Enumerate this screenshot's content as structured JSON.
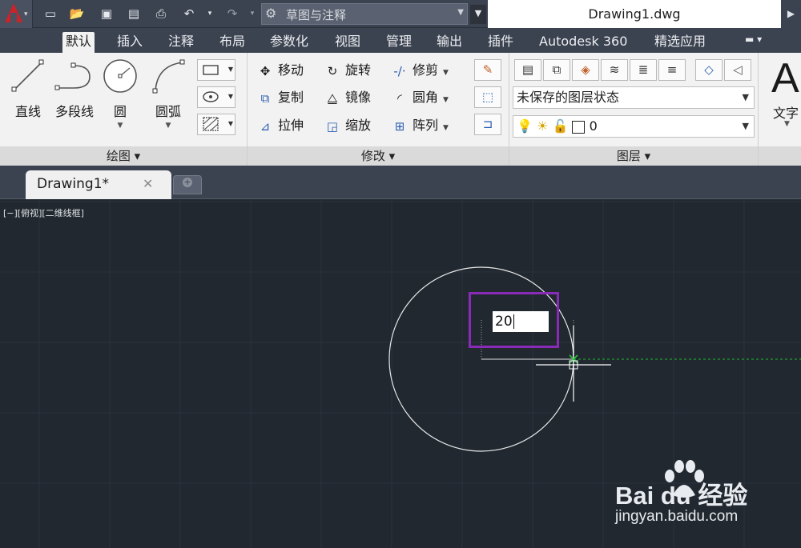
{
  "app": {
    "title": "Drawing1.dwg",
    "workspace": "草图与注释"
  },
  "ribbon_tabs": [
    "默认",
    "插入",
    "注释",
    "布局",
    "参数化",
    "视图",
    "管理",
    "输出",
    "插件",
    "Autodesk 360",
    "精选应用"
  ],
  "active_tab": "默认",
  "panels": {
    "draw": {
      "title": "绘图",
      "tools": {
        "line": "直线",
        "polyline": "多段线",
        "circle": "圆",
        "arc": "圆弧"
      }
    },
    "modify": {
      "title": "修改",
      "tools": {
        "move": "移动",
        "rotate": "旋转",
        "trim": "修剪",
        "copy": "复制",
        "mirror": "镜像",
        "fillet": "圆角",
        "stretch": "拉伸",
        "scale": "缩放",
        "array": "阵列"
      }
    },
    "layers": {
      "title": "图层",
      "state": "未保存的图层状态",
      "current_layer": "0"
    },
    "annotation": {
      "text": "文字"
    }
  },
  "document_tab": "Drawing1*",
  "viewport": {
    "label": "[−][俯视][二维线框]",
    "dimension_input": "20"
  },
  "watermark": {
    "brand": "Bai du 经验",
    "url": "jingyan.baidu.com"
  },
  "colors": {
    "accent": "#8a2bb8",
    "background": "#212830",
    "ribbon": "#f2f2f2"
  }
}
